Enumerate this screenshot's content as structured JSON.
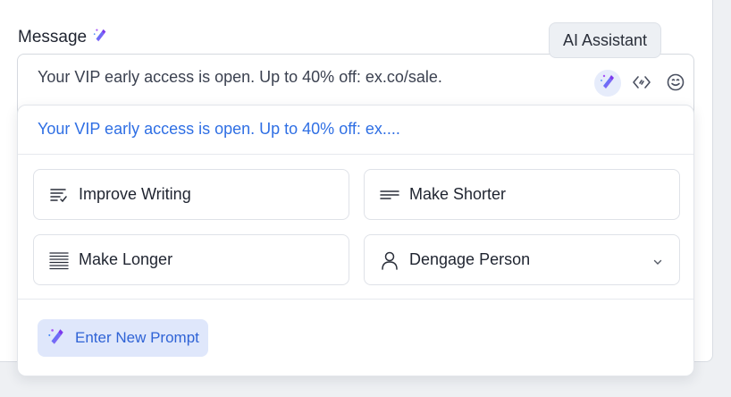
{
  "field": {
    "label": "Message",
    "label_icon": "ai-wand-icon",
    "value": "Your VIP early access is open. Up to 40% off: ex.co/sale."
  },
  "toolbar": {
    "ai_icon": "ai-wand-icon",
    "variable_icon": "code-variable-icon",
    "emoji_icon": "emoji-smile-icon",
    "tooltip": "AI Assistant"
  },
  "ai_panel": {
    "preview": "Your VIP early access is open. Up to 40% off: ex....",
    "options": [
      {
        "label": "Improve Writing",
        "icon": "improve-writing-icon"
      },
      {
        "label": "Make Shorter",
        "icon": "short-lines-icon"
      },
      {
        "label": "Make Longer",
        "icon": "long-lines-icon"
      },
      {
        "label": "Dengage Person",
        "icon": "person-icon",
        "has_dropdown": true
      }
    ],
    "new_prompt": {
      "label": "Enter New Prompt",
      "icon": "ai-wand-icon"
    }
  },
  "colors": {
    "accent": "#2f6fe4",
    "prompt_bg": "#dfe7fb",
    "wand_purple": "#8b5cf6",
    "wand_blue": "#3b82f6"
  }
}
